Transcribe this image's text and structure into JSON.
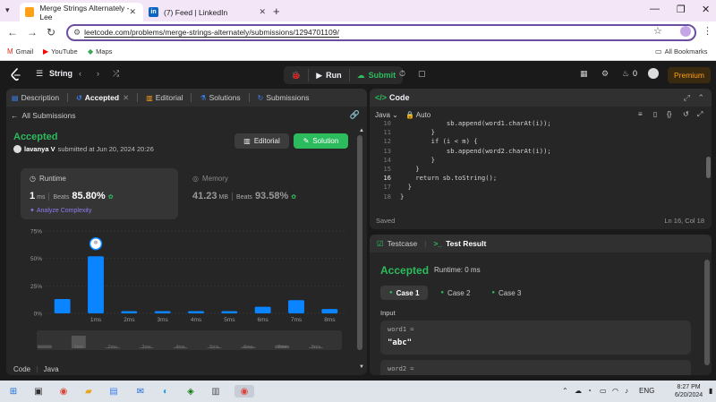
{
  "browser": {
    "tabs": [
      {
        "title": "Merge Strings Alternately - Lee",
        "active": true
      },
      {
        "title": "(7) Feed | LinkedIn",
        "active": false
      }
    ],
    "url": "leetcode.com/problems/merge-strings-alternately/submissions/1294701109/",
    "bookmarks": [
      "Gmail",
      "YouTube",
      "Maps"
    ],
    "all_bookmarks": "All Bookmarks"
  },
  "nav": {
    "problem_list": "String",
    "run": "Run",
    "submit": "Submit",
    "streak": "0",
    "premium": "Premium",
    "accent": "#ffa116"
  },
  "left": {
    "tabs": [
      {
        "label": "Description",
        "icon": "description-icon"
      },
      {
        "label": "Accepted",
        "icon": "clock-icon"
      },
      {
        "label": "Editorial",
        "icon": "book-icon"
      },
      {
        "label": "Solutions",
        "icon": "flask-icon"
      },
      {
        "label": "Submissions",
        "icon": "history-icon"
      }
    ],
    "back": "All Submissions",
    "status": "Accepted",
    "user": "lavanya V",
    "submitted": "submitted at Jun 20, 2024 20:26",
    "editorial_btn": "Editorial",
    "solution_btn": "Solution",
    "runtime": {
      "label": "Runtime",
      "value": "1",
      "unit": "ms",
      "beats_label": "Beats",
      "beats": "85.80%"
    },
    "memory": {
      "label": "Memory",
      "value": "41.23",
      "unit": "MB",
      "beats_label": "Beats",
      "beats": "93.58%"
    },
    "analyze": "Analyze Complexity",
    "code_label": "Code",
    "lang": "Java"
  },
  "chart_data": {
    "type": "bar",
    "categories": [
      "",
      "1ms",
      "2ms",
      "3ms",
      "4ms",
      "5ms",
      "6ms",
      "7ms",
      "8ms"
    ],
    "values": [
      13,
      52,
      2,
      2,
      2,
      2,
      6,
      12,
      4
    ],
    "highlight_index": 1,
    "y_ticks": [
      "75%",
      "50%",
      "25%",
      "0%"
    ],
    "ylim": [
      0,
      75
    ],
    "bar_color": "#0a84ff"
  },
  "code": {
    "title": "Code",
    "lang": "Java",
    "mode": "Auto",
    "lines": [
      {
        "n": "10",
        "text": "            sb.append(word1.charAt(i));"
      },
      {
        "n": "11",
        "text": "        }"
      },
      {
        "n": "12",
        "text": "        if (i < m) {"
      },
      {
        "n": "13",
        "text": "            sb.append(word2.charAt(i));"
      },
      {
        "n": "14",
        "text": "        }"
      },
      {
        "n": "15",
        "text": "    }"
      },
      {
        "n": "16",
        "text": "    return sb.toString();"
      },
      {
        "n": "17",
        "text": "  }"
      },
      {
        "n": "18",
        "text": "}"
      }
    ],
    "saved": "Saved",
    "cursor": "Ln 16, Col 18"
  },
  "test": {
    "tabs": [
      "Testcase",
      "Test Result"
    ],
    "status": "Accepted",
    "runtime": "Runtime: 0 ms",
    "cases": [
      "Case 1",
      "Case 2",
      "Case 3"
    ],
    "input_label": "Input",
    "inputs": [
      {
        "name": "word1 =",
        "value": "\"abc\""
      },
      {
        "name": "word2 =",
        "value": ""
      }
    ]
  },
  "taskbar": {
    "lang": "ENG",
    "time": "8:27 PM",
    "date": "6/20/2024"
  }
}
